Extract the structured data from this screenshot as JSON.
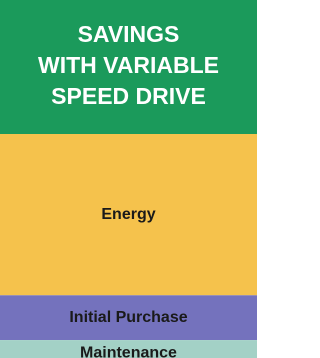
{
  "chart_data": {
    "type": "bar",
    "title_lines": [
      "SAVINGS",
      "WITH VARIABLE",
      "SPEED DRIVE"
    ],
    "categories": [
      "Savings with variable speed drive"
    ],
    "series": [
      {
        "name": "Energy",
        "values": [
          72
        ]
      },
      {
        "name": "Initial Purchase",
        "values": [
          20
        ]
      },
      {
        "name": "Maintenance",
        "values": [
          8
        ]
      }
    ],
    "colors": {
      "header": "#1b9a5b",
      "Energy": "#f5c24c",
      "Initial Purchase": "#7472bd",
      "Maintenance": "#a3d1c6"
    },
    "xlabel": "",
    "ylabel": "",
    "legend": "none",
    "grid": false
  }
}
